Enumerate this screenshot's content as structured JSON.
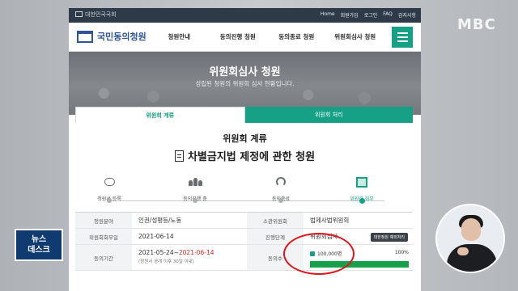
{
  "broadcast": {
    "channel_logo": "MBC",
    "news_badge": [
      "뉴스",
      "데스크"
    ]
  },
  "site": {
    "org_name": "대한민국국회",
    "util_links": [
      "Home",
      "회원가입",
      "로그인",
      "FAQ",
      "감지사항"
    ],
    "logo_text": "국민동의청원",
    "menu": [
      "청원안내",
      "동의진행 청원",
      "동의종료 청원",
      "위원회심사 청원"
    ],
    "hero": {
      "title": "위원회심사 청원",
      "subtitle": "성립된 청원의 위원회 심사 현황입니다."
    },
    "tabs": [
      {
        "label": "위원회 계류",
        "active": true
      },
      {
        "label": "위원회 처리",
        "active": false
      }
    ],
    "section_title": "위원회 계류",
    "petition_title": "차별금지법 제정에 관한 청원",
    "steps": [
      {
        "label": "청원서 등록",
        "icon": "speech-bubble-icon"
      },
      {
        "label": "동의진행 중",
        "icon": "people-icon"
      },
      {
        "label": "동의종료",
        "icon": "speaker-icon"
      },
      {
        "label": "위원회 회부",
        "icon": "documents-stack-icon",
        "active": true
      }
    ],
    "info": {
      "field_label": "청원분야",
      "field_value": "인권/성평등/노동",
      "committee_label": "소관위원회",
      "committee_value": "법제사법위원회",
      "referral_label": "위원회회부일",
      "referral_value": "2021-06-14",
      "stage_label": "진행단계",
      "stage_value": "위원회심사",
      "stage_chip": "대한청원 예외처리",
      "period_label": "동의기간",
      "period_start": "2021-05-24~",
      "period_end": "2021-06-14",
      "period_note": "(청원서 공개 이후 30일 이내)",
      "agree_label": "동의수",
      "agree_count": "100,000명",
      "agree_percent": "100%",
      "agree_fraction": 1.0
    }
  },
  "colors": {
    "accent": "#16a085",
    "progress": "#15a049",
    "highlight_ring": "#e0141c",
    "period_red": "#d52b1e"
  }
}
